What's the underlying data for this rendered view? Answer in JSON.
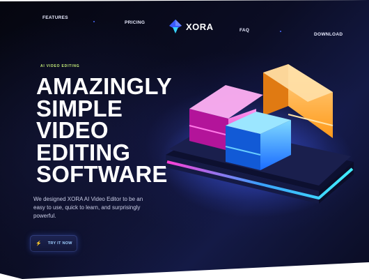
{
  "nav": {
    "features": "FEATURES",
    "pricing": "PRICING",
    "brand": "XORA",
    "faq": "FAQ",
    "download": "DOWNLOAD"
  },
  "hero": {
    "tagline": "AI VIDEO EDITING",
    "headline_lines": [
      "AMAZINGLY",
      "SIMPLE",
      "VIDEO",
      "EDITING",
      "SOFTWARE"
    ],
    "description": "We designed XORA AI Video Editor to be an easy to use, quick to learn, and surprisingly powerful.",
    "cta_label": "TRY IT NOW"
  },
  "icons": {
    "logo": "xora-logo-icon",
    "cta": "zap-icon",
    "hero": "editor-blocks-illustration"
  },
  "colors": {
    "tagline": "#c7f07a",
    "accent_blue": "#3aa0ff",
    "accent_pink": "#ff3fd6",
    "accent_orange": "#ffb03a"
  }
}
